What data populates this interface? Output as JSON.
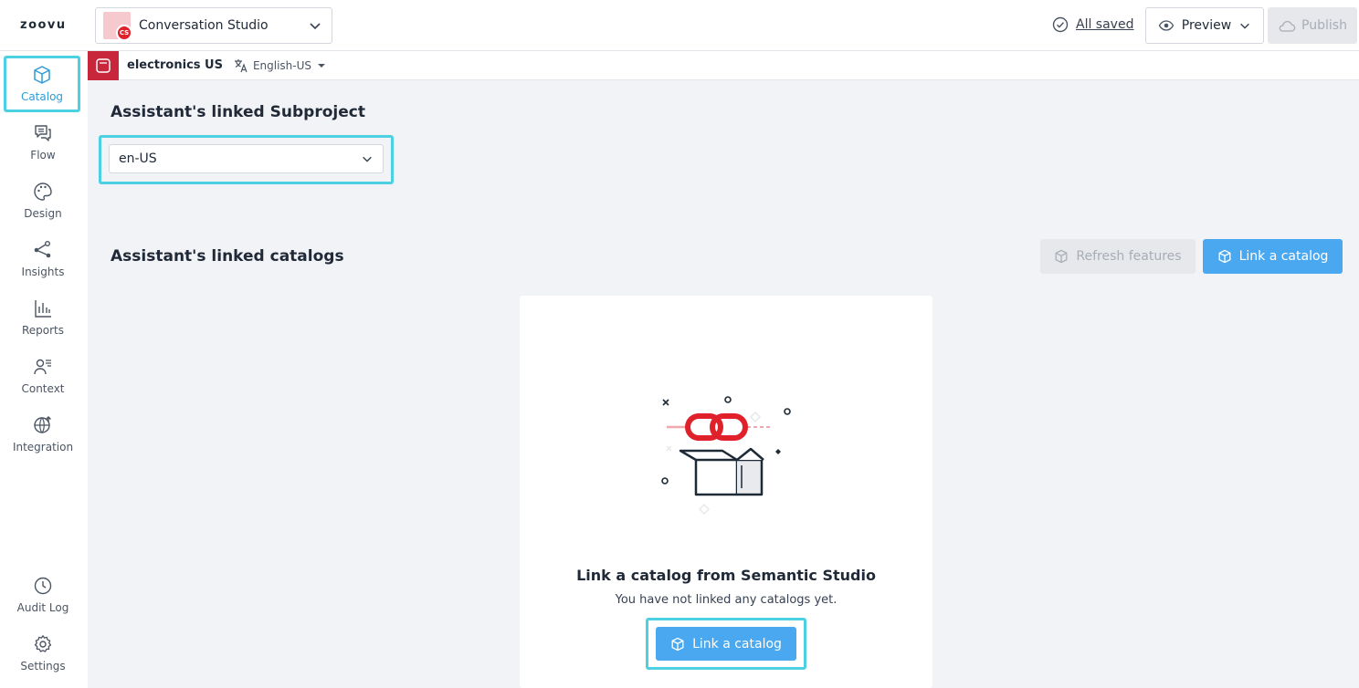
{
  "app": {
    "logo_text": "zoovu",
    "project_selector": {
      "value": "Conversation Studio",
      "badge": "CS"
    },
    "saved_status": "All saved",
    "preview_label": "Preview",
    "publish_label": "Publish"
  },
  "sidebar": {
    "items": [
      {
        "label": "Catalog",
        "icon": "box-icon",
        "active": true
      },
      {
        "label": "Flow",
        "icon": "chat-icon"
      },
      {
        "label": "Design",
        "icon": "palette-icon"
      },
      {
        "label": "Insights",
        "icon": "share-nodes-icon"
      },
      {
        "label": "Reports",
        "icon": "bar-chart-icon"
      },
      {
        "label": "Context",
        "icon": "user-list-icon"
      },
      {
        "label": "Integration",
        "icon": "globe-icon"
      }
    ],
    "bottom_items": [
      {
        "label": "Audit Log",
        "icon": "history-icon"
      },
      {
        "label": "Settings",
        "icon": "gear-icon"
      }
    ]
  },
  "subheader": {
    "assistant_name": "electronics US",
    "language": "English-US"
  },
  "main": {
    "subproject_heading": "Assistant's linked Subproject",
    "subproject_value": "en-US",
    "catalogs_heading": "Assistant's linked catalogs",
    "refresh_label": "Refresh features",
    "link_label": "Link a catalog",
    "empty_state": {
      "title": "Link a catalog from Semantic Studio",
      "subtitle": "You have not linked any catalogs yet.",
      "button_label": "Link a catalog"
    }
  },
  "colors": {
    "accent": "#4aa8f0",
    "highlight": "#4dd0e1",
    "brand_red": "#e0202a"
  }
}
